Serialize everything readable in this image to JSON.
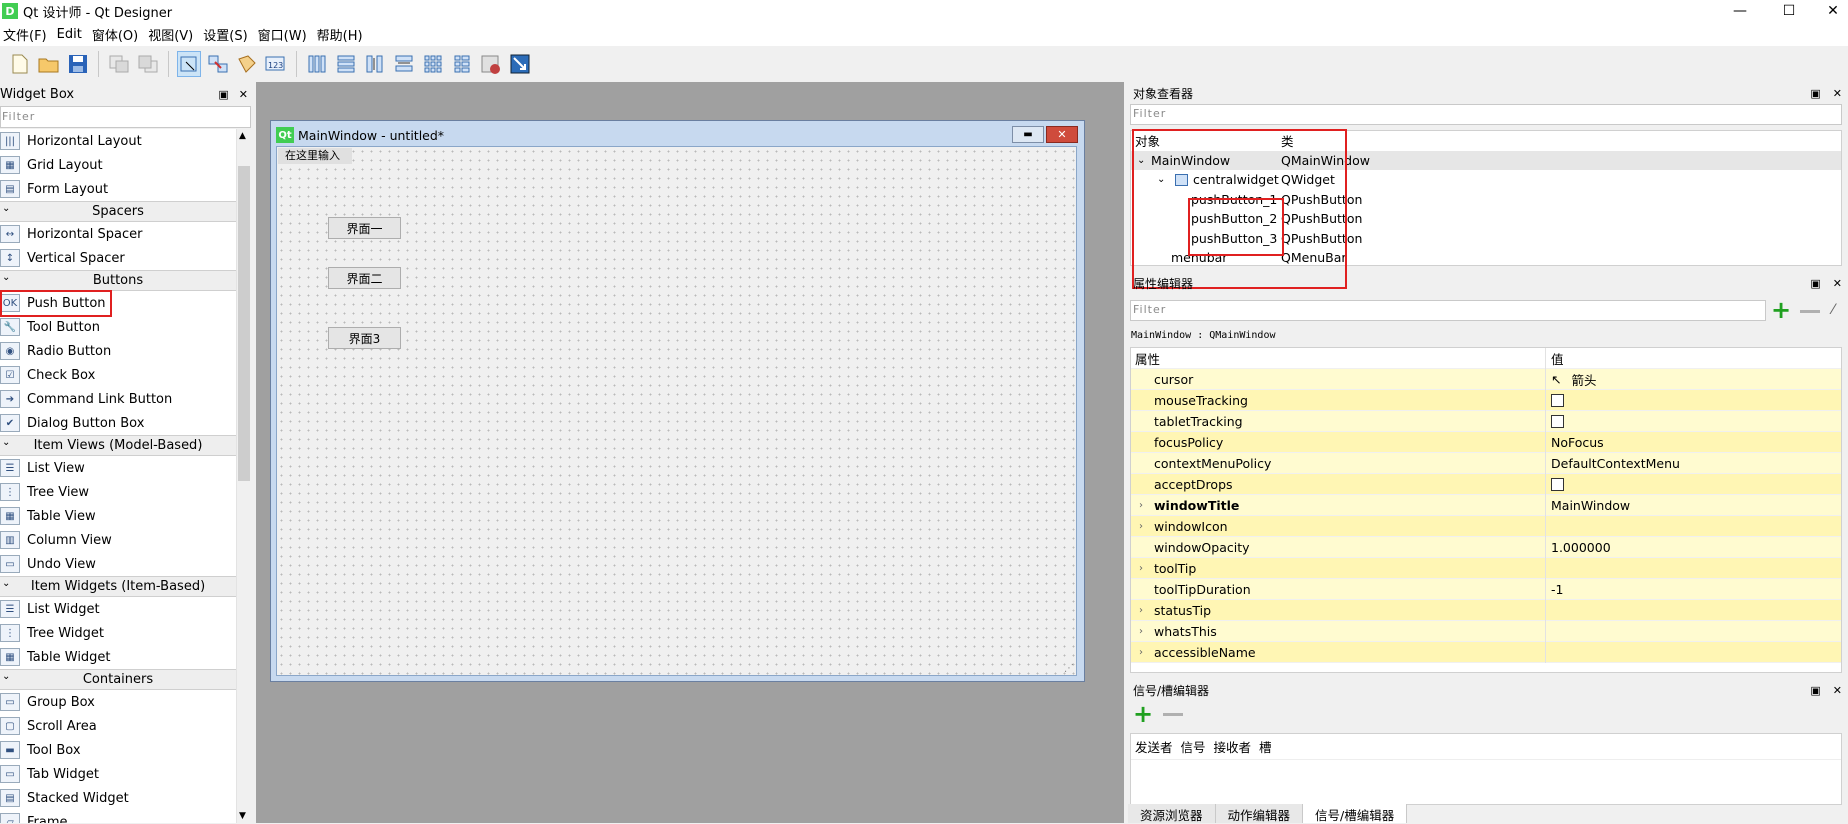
{
  "window": {
    "title": "Qt 设计师 - Qt Designer",
    "app_icon": "D",
    "minimize": "—",
    "maximize": "☐",
    "close": "✕"
  },
  "menubar": [
    "文件(F)",
    "Edit",
    "窗体(O)",
    "视图(V)",
    "设置(S)",
    "窗口(W)",
    "帮助(H)"
  ],
  "widget_box": {
    "title": "Widget Box",
    "filter_placeholder": "Filter",
    "rows": [
      {
        "kind": "item",
        "label": "Horizontal Layout",
        "icon": "horizontal-layout-icon"
      },
      {
        "kind": "item",
        "label": "Grid Layout",
        "icon": "grid-layout-icon"
      },
      {
        "kind": "item",
        "label": "Form Layout",
        "icon": "form-layout-icon"
      },
      {
        "kind": "cat",
        "label": "Spacers"
      },
      {
        "kind": "item",
        "label": "Horizontal Spacer",
        "icon": "horizontal-spacer-icon"
      },
      {
        "kind": "item",
        "label": "Vertical Spacer",
        "icon": "vertical-spacer-icon"
      },
      {
        "kind": "cat",
        "label": "Buttons"
      },
      {
        "kind": "item",
        "label": "Push Button",
        "icon": "push-button-icon"
      },
      {
        "kind": "item",
        "label": "Tool Button",
        "icon": "tool-button-icon"
      },
      {
        "kind": "item",
        "label": "Radio Button",
        "icon": "radio-button-icon"
      },
      {
        "kind": "item",
        "label": "Check Box",
        "icon": "check-box-icon"
      },
      {
        "kind": "item",
        "label": "Command Link Button",
        "icon": "command-link-icon"
      },
      {
        "kind": "item",
        "label": "Dialog Button Box",
        "icon": "dialog-button-box-icon"
      },
      {
        "kind": "cat",
        "label": "Item Views (Model-Based)"
      },
      {
        "kind": "item",
        "label": "List View",
        "icon": "list-view-icon"
      },
      {
        "kind": "item",
        "label": "Tree View",
        "icon": "tree-view-icon"
      },
      {
        "kind": "item",
        "label": "Table View",
        "icon": "table-view-icon"
      },
      {
        "kind": "item",
        "label": "Column View",
        "icon": "column-view-icon"
      },
      {
        "kind": "item",
        "label": "Undo View",
        "icon": "undo-view-icon"
      },
      {
        "kind": "cat",
        "label": "Item Widgets (Item-Based)"
      },
      {
        "kind": "item",
        "label": "List Widget",
        "icon": "list-widget-icon"
      },
      {
        "kind": "item",
        "label": "Tree Widget",
        "icon": "tree-widget-icon"
      },
      {
        "kind": "item",
        "label": "Table Widget",
        "icon": "table-widget-icon"
      },
      {
        "kind": "cat",
        "label": "Containers"
      },
      {
        "kind": "item",
        "label": "Group Box",
        "icon": "group-box-icon"
      },
      {
        "kind": "item",
        "label": "Scroll Area",
        "icon": "scroll-area-icon"
      },
      {
        "kind": "item",
        "label": "Tool Box",
        "icon": "tool-box-icon"
      },
      {
        "kind": "item",
        "label": "Tab Widget",
        "icon": "tab-widget-icon"
      },
      {
        "kind": "item",
        "label": "Stacked Widget",
        "icon": "stacked-widget-icon"
      },
      {
        "kind": "item",
        "label": "Frame",
        "icon": "frame-icon"
      }
    ]
  },
  "form": {
    "title": "MainWindow - untitled*",
    "menu_placeholder": "在这里输入",
    "buttons": [
      "界面一",
      "界面二",
      "界面3"
    ]
  },
  "object_inspector": {
    "title": "对象查看器",
    "filter_placeholder": "Filter",
    "col_object": "对象",
    "col_class": "类",
    "rows": [
      {
        "name": "MainWindow",
        "cls": "QMainWindow"
      },
      {
        "name": "centralwidget",
        "cls": "QWidget"
      },
      {
        "name": "pushButton_1",
        "cls": "QPushButton"
      },
      {
        "name": "pushButton_2",
        "cls": "QPushButton"
      },
      {
        "name": "pushButton_3",
        "cls": "QPushButton"
      },
      {
        "name": "menubar",
        "cls": "QMenuBar"
      }
    ]
  },
  "property_editor": {
    "title": "属性编辑器",
    "filter_placeholder": "Filter",
    "context": "MainWindow : QMainWindow",
    "col_property": "属性",
    "col_value": "值",
    "rows": [
      {
        "key": "cursor",
        "value": "箭头",
        "type": "cursor"
      },
      {
        "key": "mouseTracking",
        "value": "",
        "type": "check"
      },
      {
        "key": "tabletTracking",
        "value": "",
        "type": "check"
      },
      {
        "key": "focusPolicy",
        "value": "NoFocus"
      },
      {
        "key": "contextMenuPolicy",
        "value": "DefaultContextMenu"
      },
      {
        "key": "acceptDrops",
        "value": "",
        "type": "check"
      },
      {
        "key": "windowTitle",
        "value": "MainWindow",
        "bold": true,
        "expand": true
      },
      {
        "key": "windowIcon",
        "value": "",
        "expand": true
      },
      {
        "key": "windowOpacity",
        "value": "1.000000"
      },
      {
        "key": "toolTip",
        "value": "",
        "expand": true
      },
      {
        "key": "toolTipDuration",
        "value": "-1"
      },
      {
        "key": "statusTip",
        "value": "",
        "expand": true
      },
      {
        "key": "whatsThis",
        "value": "",
        "expand": true
      },
      {
        "key": "accessibleName",
        "value": "",
        "expand": true
      }
    ]
  },
  "signal_slot": {
    "title": "信号/槽编辑器",
    "headers": [
      "发送者",
      "信号",
      "接收者",
      "槽"
    ]
  },
  "bottom_tabs": [
    "资源浏览器",
    "动作编辑器",
    "信号/槽编辑器"
  ],
  "colors": {
    "highlight_red": "#e02020",
    "property_yellow": "#fffbd0",
    "property_yellow_alt": "#fff6b4"
  }
}
